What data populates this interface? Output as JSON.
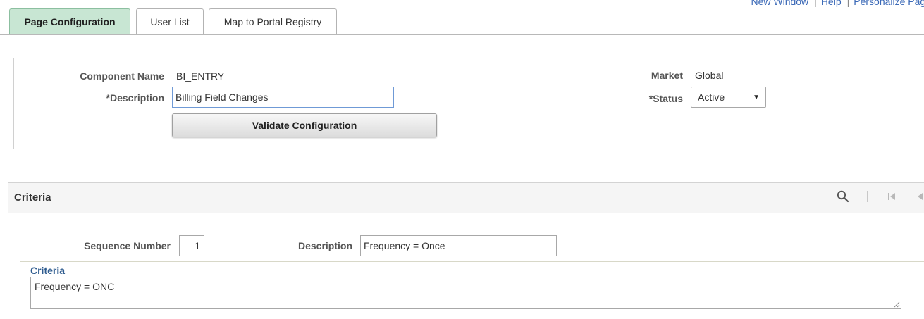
{
  "top_links": {
    "new_window": "New Window",
    "help": "Help",
    "personalize": "Personalize Page",
    "separator": "|"
  },
  "tabs": [
    {
      "label": "Page Configuration",
      "active": true
    },
    {
      "label": "User List",
      "active": false
    },
    {
      "label": "Map to Portal Registry",
      "active": false
    }
  ],
  "header": {
    "component_name_label": "Component Name",
    "component_name_value": "BI_ENTRY",
    "description_label": "*Description",
    "description_value": "Billing Field Changes",
    "validate_button": "Validate Configuration",
    "market_label": "Market",
    "market_value": "Global",
    "status_label": "*Status",
    "status_value": "Active"
  },
  "criteria_grid": {
    "title": "Criteria",
    "sequence_label": "Sequence Number",
    "sequence_value": "1",
    "description_label": "Description",
    "description_value": "Frequency = Once",
    "criteria_sub_label": "Criteria",
    "criteria_text": "Frequency = ONC"
  },
  "icons": {
    "search": "search-icon",
    "first": "first-page-icon",
    "previous": "previous-icon"
  },
  "colors": {
    "active_tab_bg": "#c8e6d3",
    "link": "#3b69b7",
    "sub_label": "#2f5c8f"
  }
}
